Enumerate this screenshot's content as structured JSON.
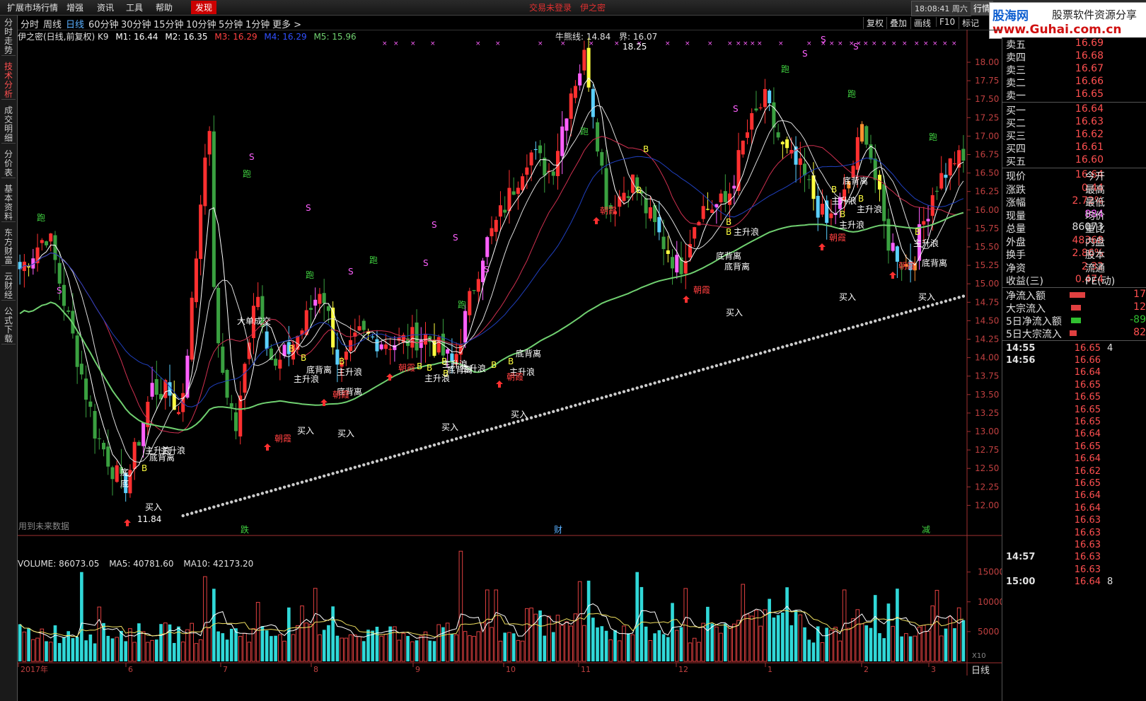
{
  "topbar": {
    "menus": [
      "扩展市场行情",
      "增强",
      "资讯",
      "工具",
      "帮助"
    ],
    "discover": "发现",
    "trade_login": "交易未登录",
    "formula_name": "伊之密",
    "time": "18:08:41",
    "weekday": "周六",
    "hq_tab": "行情"
  },
  "logo": {
    "line1": "股海网",
    "line1b": "股票软件资源分享",
    "line2": "www.Guhai.com.cn"
  },
  "sidebar": {
    "tabs": [
      "分时走势",
      "技术分析",
      "成交明细",
      "分价表",
      "基本资料",
      "东方财富",
      "云财经",
      "公式下载"
    ],
    "active_index": 1
  },
  "periods": {
    "items": [
      "分时",
      "周线",
      "日线",
      "60分钟",
      "30分钟",
      "15分钟",
      "10分钟",
      "5分钟",
      "1分钟",
      "更多 >"
    ],
    "active_index": 2
  },
  "toolbar": {
    "buttons": [
      "复权",
      "叠加",
      "画线",
      "F10",
      "标记"
    ]
  },
  "indicator_line": {
    "name": "伊之密(日线,前复权) K9",
    "m1": "M1: 16.44",
    "m2": "M2: 16.35",
    "m3": "M3: 16.29",
    "m4": "M4: 16.29",
    "m5": "M5: 15.96",
    "bull": "牛熊线: 14.84",
    "bound": "界: 16.07"
  },
  "price_axis": [
    "18.00",
    "17.75",
    "17.50",
    "17.25",
    "17.00",
    "16.75",
    "16.50",
    "16.25",
    "16.00",
    "15.75",
    "15.50",
    "15.25",
    "15.00",
    "14.75",
    "14.50",
    "14.25",
    "14.00",
    "13.75",
    "13.50",
    "13.25",
    "13.00",
    "12.75",
    "12.50",
    "12.25",
    "12.00"
  ],
  "high_label": "18.25",
  "low_label": "11.84",
  "future_note": "用到未来数据",
  "volume_info": {
    "label": "VOLUME: 86073.05",
    "ma5": "MA5: 40781.60",
    "ma10": "MA10: 42173.20"
  },
  "volume_axis": [
    "15000",
    "10000",
    "5000"
  ],
  "volume_unit": "X10",
  "date_axis": [
    "2017年",
    "6",
    "7",
    "8",
    "9",
    "10",
    "11",
    "12",
    "1",
    "2",
    "3"
  ],
  "event_markers": [
    "跌",
    "财",
    "减"
  ],
  "signals": {
    "run": "跑",
    "buy": "买入",
    "b": "B",
    "s": "S",
    "main_wave": "主升浪",
    "bottom_div": "底背离",
    "morning": "朝霞",
    "bottom": "底",
    "big_deal": "大单成交"
  },
  "quotes": {
    "asks": [
      {
        "label": "卖五",
        "price": "16.69"
      },
      {
        "label": "卖四",
        "price": "16.68"
      },
      {
        "label": "卖三",
        "price": "16.67"
      },
      {
        "label": "卖二",
        "price": "16.66"
      },
      {
        "label": "卖一",
        "price": "16.65"
      }
    ],
    "bids": [
      {
        "label": "买一",
        "price": "16.64"
      },
      {
        "label": "买二",
        "price": "16.63"
      },
      {
        "label": "买三",
        "price": "16.62"
      },
      {
        "label": "买四",
        "price": "16.61"
      },
      {
        "label": "买五",
        "price": "16.60"
      }
    ],
    "stats": [
      {
        "label": "现价",
        "value": "16.64",
        "extra": "今开"
      },
      {
        "label": "涨跌",
        "value": "0.44",
        "extra": "最高"
      },
      {
        "label": "涨幅",
        "value": "2.72%",
        "extra": "最低"
      },
      {
        "label": "现量",
        "value": "884",
        "extra": "均价"
      },
      {
        "label": "总量",
        "value": "86073",
        "extra": "量比"
      },
      {
        "label": "外盘",
        "value": "48368",
        "extra": "内盘"
      },
      {
        "label": "换手",
        "value": "2.86%",
        "extra": "股本"
      },
      {
        "label": "净资",
        "value": "2.32",
        "extra": "流通"
      },
      {
        "label": "收益(三)",
        "value": "0.474",
        "extra": "PE(动)"
      }
    ],
    "flows": [
      {
        "label": "净流入额",
        "value": "17"
      },
      {
        "label": "大宗流入",
        "value": "12"
      },
      {
        "label": "5日净流入额",
        "value": "-89"
      },
      {
        "label": "5日大宗流入",
        "value": "82"
      }
    ]
  },
  "ticks": [
    {
      "time": "14:55",
      "price": "16.65",
      "vol": "4"
    },
    {
      "time": "14:56",
      "price": "16.66"
    },
    {
      "time": "",
      "price": "16.64"
    },
    {
      "time": "",
      "price": "16.65"
    },
    {
      "time": "",
      "price": "16.65"
    },
    {
      "time": "",
      "price": "16.65"
    },
    {
      "time": "",
      "price": "16.65"
    },
    {
      "time": "",
      "price": "16.64"
    },
    {
      "time": "",
      "price": "16.65"
    },
    {
      "time": "",
      "price": "16.64"
    },
    {
      "time": "",
      "price": "16.62"
    },
    {
      "time": "",
      "price": "16.65"
    },
    {
      "time": "",
      "price": "16.64"
    },
    {
      "time": "",
      "price": "16.64"
    },
    {
      "time": "",
      "price": "16.63"
    },
    {
      "time": "",
      "price": "16.63"
    },
    {
      "time": "",
      "price": "16.63"
    },
    {
      "time": "14:57",
      "price": "16.63"
    },
    {
      "time": "",
      "price": "16.63"
    },
    {
      "time": "15:00",
      "price": "16.64",
      "vol": "8"
    }
  ],
  "bottom_tab": "日线",
  "colors": {
    "up": "#ff3030",
    "down": "#00cfcf",
    "magenta": "#ff60ff",
    "yellow": "#ffff40",
    "green_ma": "#70d070",
    "blue_ma": "#2040c0"
  }
}
